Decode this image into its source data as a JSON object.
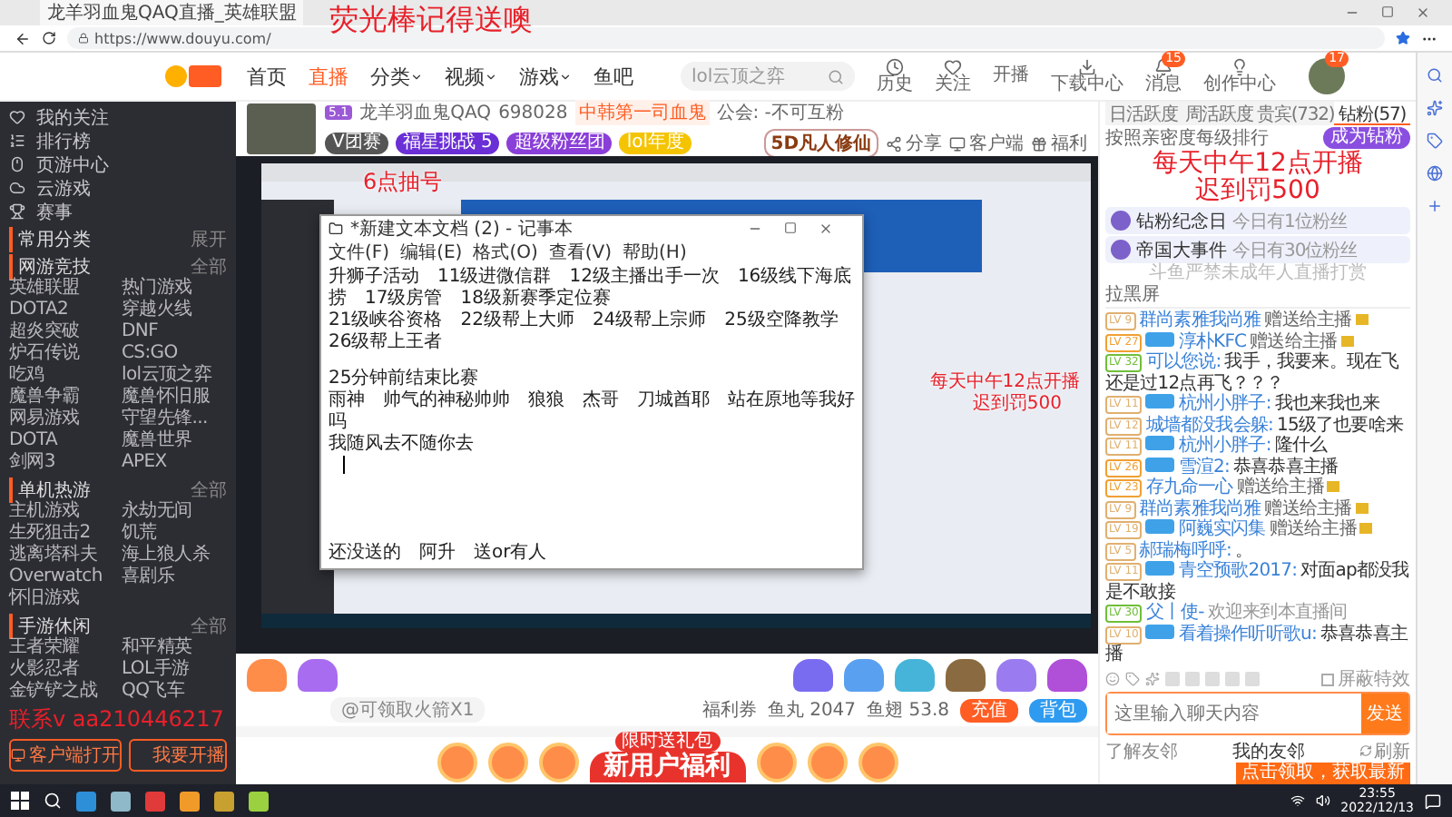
{
  "browser": {
    "tab_title": "龙羊羽血鬼QAQ直播_英雄联盟",
    "url": "https://www.douyu.com/"
  },
  "site_header": {
    "nav": [
      {
        "label": "首页",
        "selected": false,
        "dropdown": false
      },
      {
        "label": "直播",
        "selected": true,
        "dropdown": false
      },
      {
        "label": "分类",
        "selected": false,
        "dropdown": true
      },
      {
        "label": "视频",
        "selected": false,
        "dropdown": true
      },
      {
        "label": "游戏",
        "selected": false,
        "dropdown": true
      },
      {
        "label": "鱼吧",
        "selected": false,
        "dropdown": false
      }
    ],
    "search": {
      "placeholder": "lol云顶之弈"
    },
    "actions": [
      {
        "label": "历史",
        "kind": "history"
      },
      {
        "label": "关注",
        "kind": "follow"
      },
      {
        "label": "开播",
        "kind": "broadcast"
      },
      {
        "label": "下载中心",
        "kind": "download"
      },
      {
        "label": "消息",
        "kind": "message",
        "badge": "15"
      },
      {
        "label": "创作中心",
        "kind": "create"
      }
    ],
    "avatar_badge": "17"
  },
  "sidebar": {
    "top": [
      {
        "label": "我的关注",
        "kind": "heart"
      },
      {
        "label": "排行榜",
        "kind": "rank"
      },
      {
        "label": "页游中心",
        "kind": "mouse"
      },
      {
        "label": "云游戏",
        "kind": "cloud"
      },
      {
        "label": "赛事",
        "kind": "trophy"
      }
    ],
    "sections": [
      {
        "title": "常用分类",
        "action": "展开"
      },
      {
        "title": "网游竞技",
        "action": "全部",
        "items": [
          "英雄联盟",
          "热门游戏",
          "DOTA2",
          "穿越火线",
          "超炎突破",
          "DNF",
          "炉石传说",
          "CS:GO",
          "吃鸡",
          "lol云顶之弈",
          "魔兽争霸",
          "魔兽怀旧服",
          "网易游戏",
          "守望先锋...",
          "DOTA",
          "魔兽世界",
          "剑网3",
          "APEX"
        ]
      },
      {
        "title": "单机热游",
        "action": "全部",
        "items": [
          "主机游戏",
          "永劫无间",
          "生死狙击2",
          "饥荒",
          "逃离塔科夫",
          "海上狼人杀",
          "Overwatch",
          "喜剧乐",
          "怀旧游戏"
        ]
      },
      {
        "title": "手游休闲",
        "action": "全部",
        "items": [
          "王者荣耀",
          "和平精英",
          "火影忍者",
          "LOL手游",
          "金铲铲之战",
          "QQ飞车"
        ]
      }
    ],
    "buttons": [
      {
        "label": "客户端打开",
        "kind": "monitor"
      },
      {
        "label": "我要开播",
        "kind": "video"
      }
    ]
  },
  "streamer": {
    "level": "5.1",
    "name": "龙羊羽血鬼QAQ",
    "hot": "698028",
    "tag": "中韩第一司血鬼",
    "guild": "公会: -不可互粉",
    "badges": [
      "V团赛",
      "福星挑战 5",
      "超级粉丝团",
      "lol年度"
    ],
    "ad": "5D凡人修仙",
    "actions": [
      {
        "label": "分享",
        "kind": "share"
      },
      {
        "label": "客户端",
        "kind": "client"
      },
      {
        "label": "福利",
        "kind": "gift"
      }
    ]
  },
  "notepad": {
    "title": "*新建文本文档 (2) - 记事本",
    "menu": [
      "文件(F)",
      "编辑(E)",
      "格式(O)",
      "查看(V)",
      "帮助(H)"
    ],
    "lines": [
      "升狮子活动　11级进微信群　12级主播出手一次　16级线下海底捞　17级房管　18级新赛季定位赛",
      "21级峡谷资格　22级帮上大师　24级帮上宗师　25级空降教学　26级帮上王者",
      "25分钟前结束比赛",
      "雨神　帅气的神秘帅帅　狼狼　杰哥　刀城酋耶　站在原地等我好吗",
      "我随风去不随你去"
    ],
    "footer_line": "还没送的　阿升　送or有人"
  },
  "overlays": {
    "top": "荧光棒记得送噢",
    "draw": "6点抽号",
    "video_schedule": [
      "每天中午12点开播",
      "迟到罚500"
    ],
    "schedule": [
      "每天中午12点开播",
      "迟到罚500"
    ],
    "contact": "联系v aa210446217"
  },
  "gift_bar": {
    "notice": "@可领取火箭X1",
    "coupon": "福利券",
    "fish_balls": "鱼丸 2047",
    "fish_fins": "鱼翅 53.8",
    "recharge": "充值",
    "bag": "背包"
  },
  "banner": {
    "ribbon": "限时送礼包",
    "title": "新用户福利"
  },
  "chat": {
    "tabs": [
      {
        "label": "日活跃度",
        "selected": false
      },
      {
        "label": "周活跃度",
        "selected": false
      },
      {
        "label": "贵宾(732)",
        "selected": false
      },
      {
        "label": "钻粉(57)",
        "selected": true
      }
    ],
    "rank_hint": "按照亲密度每级排行",
    "become_fan": "成为钻粉",
    "events": [
      {
        "title": "钻粉纪念日",
        "note": "今日有1位粉丝"
      },
      {
        "title": "帝国大事件",
        "note": "今日有30位粉丝"
      }
    ],
    "notice": "斗鱼严禁未成年人直播打赏",
    "blocked": "拉黑屏",
    "messages": [
      {
        "level": "LV 9",
        "user": "群尚素雅我尚雅",
        "text": "赠送给主播",
        "kind": "gift",
        "fan": false
      },
      {
        "level": "LV 27",
        "user": "淳朴KFC",
        "text": "赠送给主播",
        "kind": "gift",
        "fan": true
      },
      {
        "level": "LV 32",
        "user": "可以您说:",
        "text": "我手，我要来。现在飞还是过12点再飞？？？",
        "kind": "chat",
        "fan": false
      },
      {
        "level": "LV 11",
        "user": "杭州小胖子:",
        "text": "我也来我也来",
        "kind": "chat",
        "fan": true
      },
      {
        "level": "LV 12",
        "user": "城墙都没我会躲:",
        "text": "15级了也要啥来",
        "kind": "chat",
        "fan": false
      },
      {
        "level": "LV 11",
        "user": "杭州小胖子:",
        "text": "隆什么",
        "kind": "chat",
        "fan": true
      },
      {
        "level": "LV 26",
        "user": "雪渲2:",
        "text": "恭喜恭喜主播",
        "kind": "chat",
        "fan": true
      },
      {
        "level": "LV 23",
        "user": "存九命一心",
        "text": "赠送给主播",
        "kind": "gift",
        "fan": false
      },
      {
        "level": "LV 9",
        "user": "群尚素雅我尚雅",
        "text": "赠送给主播",
        "kind": "gift",
        "fan": false
      },
      {
        "level": "LV 19",
        "user": "阿巍实闪集",
        "text": "赠送给主播",
        "kind": "gift",
        "fan": true
      },
      {
        "level": "LV 5",
        "user": "郝瑞梅呼呼:",
        "text": "。",
        "kind": "chat",
        "fan": false
      },
      {
        "level": "LV 11",
        "user": "青空预歌2017:",
        "text": "对面ap都没我是不敢接",
        "kind": "chat",
        "fan": true
      },
      {
        "level": "LV 30",
        "user": "父丨使-",
        "text": "欢迎来到本直播间",
        "kind": "enter",
        "fan": false
      },
      {
        "level": "LV 10",
        "user": "看着操作听听歌u:",
        "text": "恭喜恭喜主播",
        "kind": "chat",
        "fan": true
      }
    ],
    "effects_toggle": {
      "label": "屏蔽特效",
      "checked": false
    },
    "input": {
      "placeholder": "这里输入聊天内容"
    },
    "send": "发送",
    "friends": {
      "about": "了解友邻",
      "title": "我的友邻",
      "refresh": "刷新"
    },
    "promo": "点击领取，获取最新"
  },
  "taskbar": {
    "time": "23:55",
    "date": "2022/12/13"
  }
}
